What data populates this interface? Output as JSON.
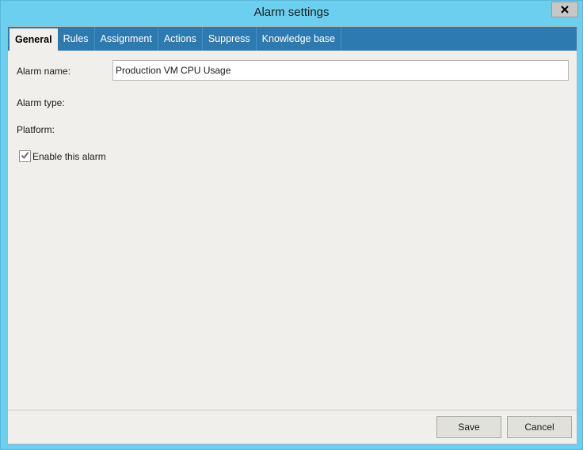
{
  "window": {
    "title": "Alarm settings",
    "colors": {
      "frame": "#6dcff0",
      "tabbar": "#2d7ab0",
      "client": "#f0efeb"
    }
  },
  "close_button": {
    "icon": "close-icon"
  },
  "tabs": [
    {
      "label": "General",
      "active": true
    },
    {
      "label": "Rules",
      "active": false
    },
    {
      "label": "Assignment",
      "active": false
    },
    {
      "label": "Actions",
      "active": false
    },
    {
      "label": "Suppress",
      "active": false
    },
    {
      "label": "Knowledge base",
      "active": false
    }
  ],
  "general": {
    "alarm_name_label": "Alarm name:",
    "alarm_name_value": "Production VM CPU Usage",
    "alarm_type_label": "Alarm type:",
    "platform_label": "Platform:",
    "enable_label": "Enable this alarm",
    "enable_checked": true
  },
  "footer": {
    "save_label": "Save",
    "cancel_label": "Cancel"
  }
}
